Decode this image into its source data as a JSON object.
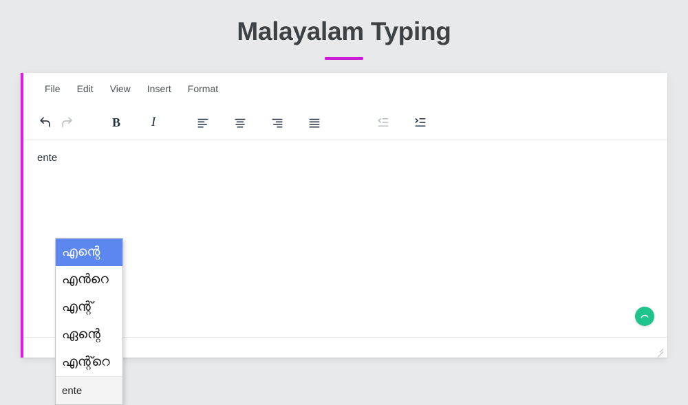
{
  "page": {
    "title": "Malayalam Typing",
    "background_color": "#e8e9ea",
    "accent_color": "#cc1bd4"
  },
  "editor": {
    "accent_bar_color": "#e319e8",
    "menubar": {
      "items": [
        {
          "label": "File"
        },
        {
          "label": "Edit"
        },
        {
          "label": "View"
        },
        {
          "label": "Insert"
        },
        {
          "label": "Format"
        }
      ]
    },
    "toolbar": {
      "buttons": [
        {
          "name": "undo",
          "icon": "undo-icon",
          "label": "",
          "enabled": true
        },
        {
          "name": "redo",
          "icon": "redo-icon",
          "label": "",
          "enabled": false
        },
        {
          "name": "bold",
          "icon": "bold-icon",
          "label": "B",
          "enabled": true
        },
        {
          "name": "italic",
          "icon": "italic-icon",
          "label": "I",
          "enabled": true
        },
        {
          "name": "align-left",
          "icon": "align-left-icon",
          "label": "",
          "enabled": true
        },
        {
          "name": "align-center",
          "icon": "align-center-icon",
          "label": "",
          "enabled": true
        },
        {
          "name": "align-right",
          "icon": "align-right-icon",
          "label": "",
          "enabled": true
        },
        {
          "name": "align-justify",
          "icon": "align-justify-icon",
          "label": "",
          "enabled": true
        },
        {
          "name": "outdent",
          "icon": "outdent-icon",
          "label": "",
          "enabled": false
        },
        {
          "name": "indent",
          "icon": "indent-icon",
          "label": "",
          "enabled": true
        }
      ]
    },
    "content": {
      "typed_text": "ente"
    },
    "suggestions": {
      "selected_index": 0,
      "items": [
        {
          "text": "എന്റെ",
          "selected": true,
          "is_raw": false
        },
        {
          "text": "എൻറെ",
          "selected": false,
          "is_raw": false
        },
        {
          "text": "എന്റ്",
          "selected": false,
          "is_raw": false
        },
        {
          "text": "ഏന്റെ",
          "selected": false,
          "is_raw": false
        },
        {
          "text": "എന്റ്റെ",
          "selected": false,
          "is_raw": false
        },
        {
          "text": "ente",
          "selected": false,
          "is_raw": true
        }
      ],
      "highlight_color": "#5b87ef"
    },
    "status_badge": {
      "icon": "spinner-icon",
      "color": "#1fc48c"
    },
    "resize_handle": {
      "icon": "resize-grip-icon"
    }
  }
}
